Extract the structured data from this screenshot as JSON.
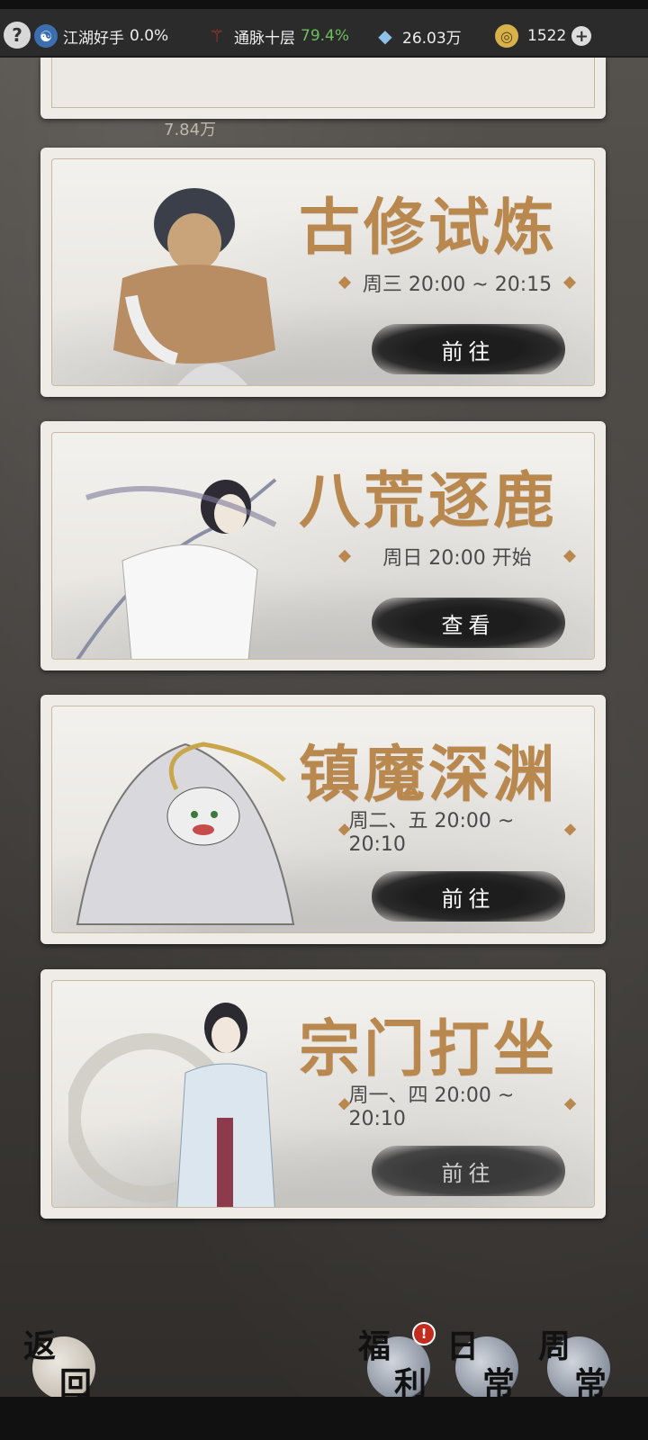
{
  "topbar": {
    "help_symbol": "?",
    "rank": {
      "label": "江湖好手",
      "pct": "0.0%",
      "icon": "yin-yang-icon"
    },
    "cultivation": {
      "label": "通脉十层",
      "pct": "79.4%",
      "pct_color": "#6fbf5e",
      "icon": "meridian-icon"
    },
    "spirit_stones": {
      "value": "26.03万",
      "icon": "crystal-icon"
    },
    "gold": {
      "value": "1522",
      "icon": "gold-coin-icon",
      "plus": "+"
    }
  },
  "partial_card": {
    "ghost_value": "7.84万"
  },
  "events": [
    {
      "title": "古修试炼",
      "schedule": "周三  20:00 ~ 20:15",
      "button": "前往",
      "figure": "muscular-warrior-illustration"
    },
    {
      "title": "八荒逐鹿",
      "schedule": "周日 20:00 开始",
      "button": "查看",
      "figure": "swordsman-illustration"
    },
    {
      "title": "镇魔深渊",
      "schedule": "周二、五  20:00 ~ 20:10",
      "button": "前往",
      "figure": "demon-beast-illustration"
    },
    {
      "title": "宗门打坐",
      "schedule": "周一、四  20:00 ~ 20:10",
      "button": "前往",
      "figure": "scholar-illustration"
    }
  ],
  "bottom": {
    "back": [
      "返",
      "回"
    ],
    "welfare": [
      "福",
      "利"
    ],
    "welfare_badge": "!",
    "daily": [
      "日",
      "常"
    ],
    "weekly": [
      "周",
      "常"
    ]
  },
  "colors": {
    "accent": "#b9884f",
    "card": "#efece7",
    "button": "#1d1d1d"
  }
}
